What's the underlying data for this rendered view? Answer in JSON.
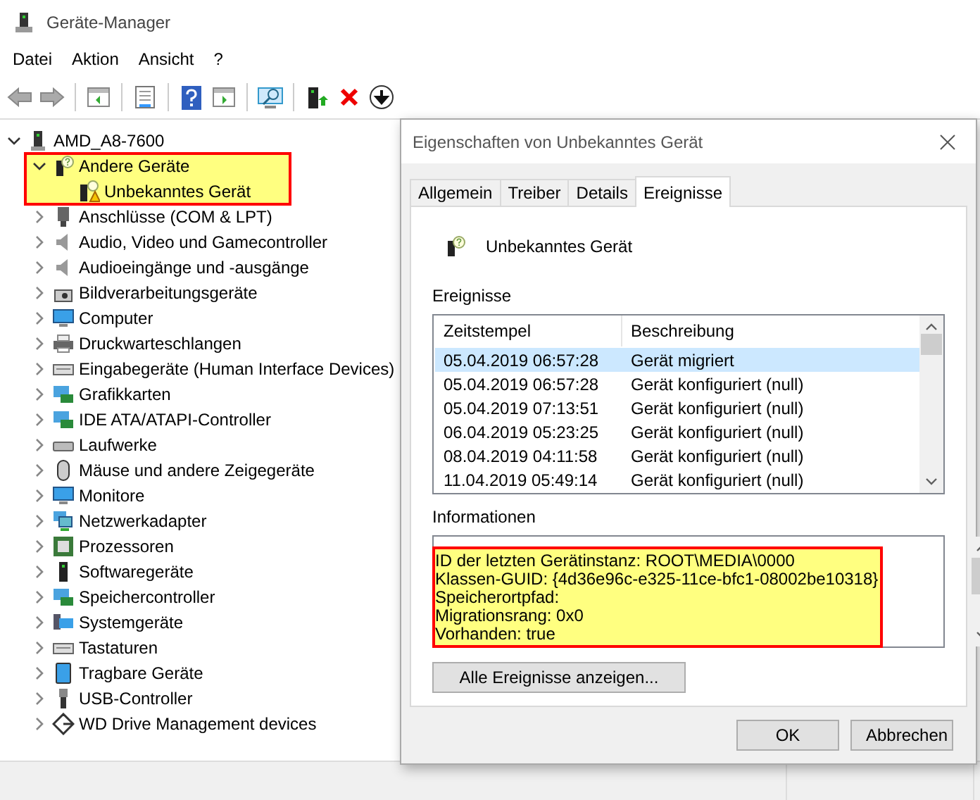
{
  "window": {
    "title": "Geräte-Manager"
  },
  "menu": [
    "Datei",
    "Aktion",
    "Ansicht",
    "?"
  ],
  "tree": {
    "label": "AMD_A8-7600",
    "expanded": true,
    "children": [
      {
        "label": "Andere Geräte",
        "expanded": true,
        "highlighted": true,
        "children": [
          {
            "label": "Unbekanntes Gerät",
            "warning": true
          }
        ]
      },
      {
        "label": "Anschlüsse (COM & LPT)",
        "expanded": false
      },
      {
        "label": "Audio, Video und Gamecontroller",
        "expanded": false
      },
      {
        "label": "Audioeingänge und -ausgänge",
        "expanded": false
      },
      {
        "label": "Bildverarbeitungsgeräte",
        "expanded": false
      },
      {
        "label": "Computer",
        "expanded": false
      },
      {
        "label": "Druckwarteschlangen",
        "expanded": false
      },
      {
        "label": "Eingabegeräte (Human Interface Devices)",
        "expanded": false
      },
      {
        "label": "Grafikkarten",
        "expanded": false
      },
      {
        "label": "IDE ATA/ATAPI-Controller",
        "expanded": false
      },
      {
        "label": "Laufwerke",
        "expanded": false
      },
      {
        "label": "Mäuse und andere Zeigegeräte",
        "expanded": false
      },
      {
        "label": "Monitore",
        "expanded": false
      },
      {
        "label": "Netzwerkadapter",
        "expanded": false
      },
      {
        "label": "Prozessoren",
        "expanded": false
      },
      {
        "label": "Softwaregeräte",
        "expanded": false
      },
      {
        "label": "Speichercontroller",
        "expanded": false
      },
      {
        "label": "Systemgeräte",
        "expanded": false
      },
      {
        "label": "Tastaturen",
        "expanded": false
      },
      {
        "label": "Tragbare Geräte",
        "expanded": false
      },
      {
        "label": "USB-Controller",
        "expanded": false
      },
      {
        "label": "WD Drive Management devices",
        "expanded": false
      }
    ]
  },
  "dialog": {
    "title": "Eigenschaften von Unbekanntes Gerät",
    "tabs": [
      {
        "label": "Allgemein",
        "selected": false
      },
      {
        "label": "Treiber",
        "selected": false
      },
      {
        "label": "Details",
        "selected": false
      },
      {
        "label": "Ereignisse",
        "selected": true
      }
    ],
    "device_name": "Unbekanntes Gerät",
    "events_label": "Ereignisse",
    "columns": [
      "Zeitstempel",
      "Beschreibung"
    ],
    "rows": [
      {
        "timestamp": "05.04.2019 06:57:28",
        "description": "Gerät migriert",
        "selected": true
      },
      {
        "timestamp": "05.04.2019 06:57:28",
        "description": "Gerät konfiguriert (null)",
        "selected": false
      },
      {
        "timestamp": "05.04.2019 07:13:51",
        "description": "Gerät konfiguriert (null)",
        "selected": false
      },
      {
        "timestamp": "06.04.2019 05:23:25",
        "description": "Gerät konfiguriert (null)",
        "selected": false
      },
      {
        "timestamp": "08.04.2019 04:11:58",
        "description": "Gerät konfiguriert (null)",
        "selected": false
      },
      {
        "timestamp": "11.04.2019 05:49:14",
        "description": "Gerät konfiguriert (null)",
        "selected": false
      }
    ],
    "info_label": "Informationen",
    "info": {
      "highlighted": true,
      "lines": [
        "ID der letzten Gerätinstanz: ROOT\\MEDIA\\0000",
        "Klassen-GUID: {4d36e96c-e325-11ce-bfc1-08002be10318}",
        "Speicherortpfad:",
        "Migrationsrang: 0x0",
        "Vorhanden: true"
      ]
    },
    "all_events_button": "Alle Ereignisse anzeigen...",
    "buttons": [
      "OK",
      "Abbrechen"
    ]
  }
}
